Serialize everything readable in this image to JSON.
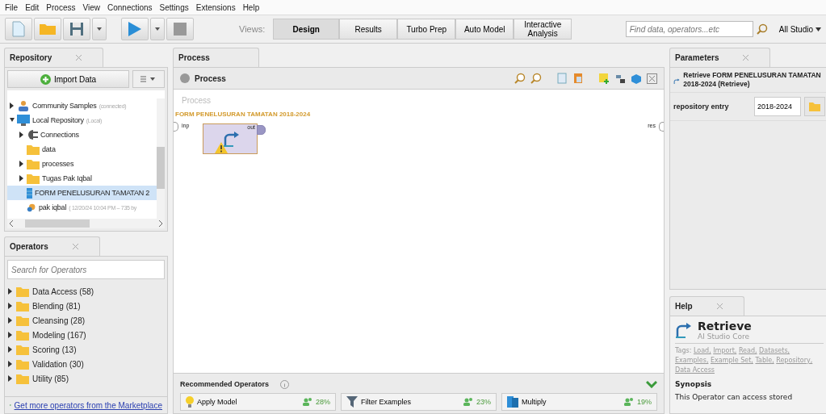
{
  "menu": [
    "File",
    "Edit",
    "Process",
    "View",
    "Connections",
    "Settings",
    "Extensions",
    "Help"
  ],
  "toolbar": {
    "views_label": "Views:",
    "views": [
      {
        "label": "Design",
        "selected": true
      },
      {
        "label": "Results",
        "selected": false
      },
      {
        "label": "Turbo Prep",
        "selected": false
      },
      {
        "label": "Auto Model",
        "selected": false
      },
      {
        "label": "Interactive Analysis",
        "selected": false
      }
    ],
    "search": {
      "placeholder": "Find data, operators...etc"
    },
    "scope": "All Studio"
  },
  "repository": {
    "tab": "Repository",
    "import_button": "Import Data",
    "tree": [
      {
        "label": "Community Samples",
        "note": "(connected)",
        "kind": "people",
        "expanded": false,
        "selected": false
      },
      {
        "label": "Local Repository",
        "note": "(Local)",
        "kind": "monitor",
        "expanded": true,
        "selected": false,
        "children": [
          {
            "label": "Connections",
            "kind": "plug",
            "expanded": false,
            "selected": false
          },
          {
            "label": "data",
            "kind": "folder",
            "selected": false
          },
          {
            "label": "processes",
            "kind": "folder",
            "expanded": false,
            "selected": false
          },
          {
            "label": "Tugas Pak Iqbal",
            "kind": "folder",
            "expanded": false,
            "selected": false
          },
          {
            "label": "FORM PENELUSURAN TAMATAN 2",
            "kind": "data",
            "selected": true
          },
          {
            "label": "pak iqbal",
            "note": "( 12/20/24 10:04 PM – 735 by",
            "kind": "process",
            "selected": false
          }
        ]
      }
    ]
  },
  "operators": {
    "tab": "Operators",
    "search": {
      "placeholder": "Search for Operators"
    },
    "groups": [
      {
        "label": "Data Access (58)",
        "expanded": false
      },
      {
        "label": "Blending (81)",
        "expanded": false
      },
      {
        "label": "Cleansing (28)",
        "expanded": false
      },
      {
        "label": "Modeling (167)",
        "expanded": false
      },
      {
        "label": "Scoring (13)",
        "expanded": false
      },
      {
        "label": "Validation (30)",
        "expanded": false
      },
      {
        "label": "Utility (85)",
        "expanded": false
      }
    ],
    "marketplace_link": "Get more operators from the Marketplace"
  },
  "process": {
    "tab": "Process",
    "breadcrumb": "Process",
    "canvas_label": "Process",
    "process_title": "FORM PENELUSURAN TAMATAN 2018-2024",
    "input_port": "inp",
    "output_port": "res",
    "operator": {
      "port": "out",
      "warning": true
    },
    "recommended": {
      "title": "Recommended Operators",
      "items": [
        {
          "name": "Apply Model",
          "kind": "bulb",
          "share": "28%"
        },
        {
          "name": "Filter Examples",
          "kind": "filter",
          "share": "23%"
        },
        {
          "name": "Multiply",
          "kind": "multiply",
          "share": "19%"
        }
      ]
    }
  },
  "parameters": {
    "tab": "Parameters",
    "heading": "Retrieve FORM PENELUSURAN TAMATAN 2018-2024 (Retrieve)",
    "rows": [
      {
        "label": "repository entry",
        "value": "2018-2024"
      }
    ]
  },
  "help": {
    "tab": "Help",
    "title": "Retrieve",
    "subtitle": "AI Studio Core",
    "tags_label": "Tags:",
    "tags": [
      "Load,",
      "Import,",
      "Read,",
      "Datasets,",
      "Examples,",
      "Example Set,",
      "Table,",
      "Repository,",
      "Data Access"
    ],
    "section": "Synopsis",
    "text": "This Operator can access stored"
  }
}
